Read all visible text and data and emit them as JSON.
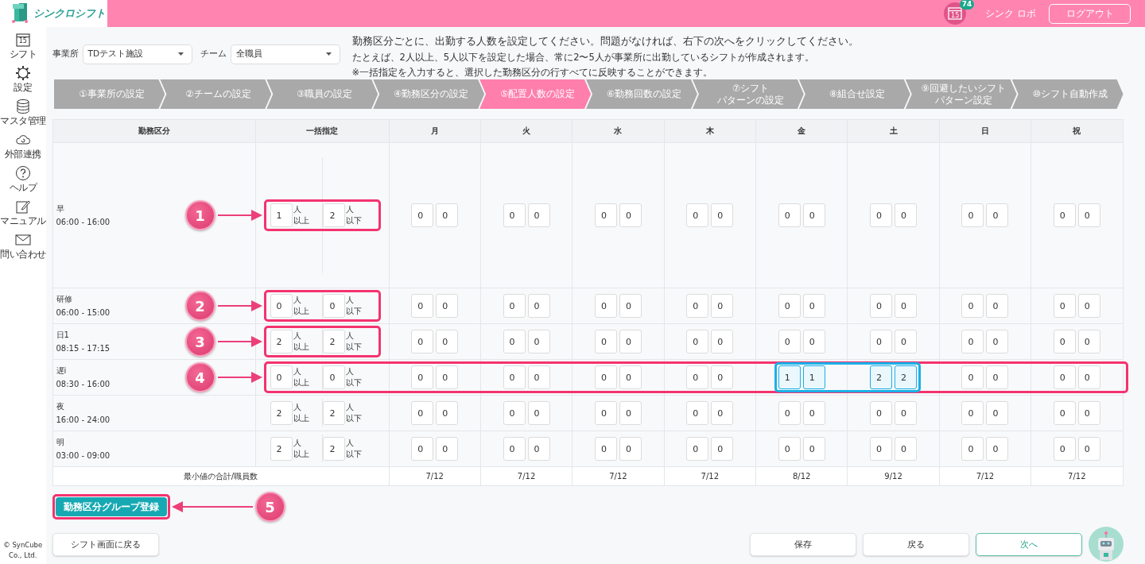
{
  "header": {
    "logo": "シンクロシフト",
    "calendar_day": "15",
    "notification_count": "74",
    "user_name": "シンク ロボ",
    "logout": "ログアウト"
  },
  "sidebar": {
    "items": [
      {
        "label": "シフト",
        "icon_text": "15"
      },
      {
        "label": "設定"
      },
      {
        "label": "マスタ管理"
      },
      {
        "label": "外部連携"
      },
      {
        "label": "ヘルプ"
      },
      {
        "label": "マニュアル"
      },
      {
        "label": "問い合わせ"
      }
    ],
    "copyright": "© SynCube Co., Ltd."
  },
  "filters": [
    {
      "label": "事業所",
      "value": "TDテスト施設"
    },
    {
      "label": "チーム",
      "value": "全職員"
    }
  ],
  "instructions": [
    "勤務区分ごとに、出勤する人数を設定してください。問題がなければ、右下の次へをクリックしてください。",
    "たとえば、2人以上、5人以下を設定した場合、常に2〜5人が事業所に出勤しているシフトが作成されます。",
    "※一括指定を入力すると、選択した勤務区分の行すべてに反映することができます。"
  ],
  "steps": [
    {
      "lines": [
        "①事業所の設定"
      ],
      "selected": false
    },
    {
      "lines": [
        "②チームの設定"
      ],
      "selected": false
    },
    {
      "lines": [
        "③職員の設定"
      ],
      "selected": false
    },
    {
      "lines": [
        "④勤務区分の設定"
      ],
      "selected": false
    },
    {
      "lines": [
        "⑤配置人数の設定"
      ],
      "selected": true
    },
    {
      "lines": [
        "⑥勤務回数の設定"
      ],
      "selected": false
    },
    {
      "lines": [
        "⑦シフト",
        "パターンの設定"
      ],
      "selected": false
    },
    {
      "lines": [
        "⑧組合せ設定"
      ],
      "selected": false
    },
    {
      "lines": [
        "⑨回避したいシフト",
        "パターン設定"
      ],
      "selected": false
    },
    {
      "lines": [
        "⑩シフト自動作成"
      ],
      "selected": false
    }
  ],
  "table": {
    "columns": [
      "勤務区分",
      "一括指定",
      "月",
      "火",
      "水",
      "木",
      "金",
      "土",
      "日",
      "祝"
    ],
    "rows": [
      {
        "name": "早",
        "time": "06:00 - 16:00",
        "kind": "tall",
        "callout": {
          "number": "1",
          "kind": "bulk"
        },
        "bulk": [
          {
            "value": "1",
            "unit": [
              "人",
              "以上"
            ]
          },
          {
            "value": "2",
            "unit": [
              "人",
              "以下"
            ]
          }
        ],
        "days": [
          {
            "min": "0",
            "max": "0",
            "highlighted": false
          },
          {
            "min": "0",
            "max": "0",
            "highlighted": false
          },
          {
            "min": "0",
            "max": "0",
            "highlighted": false
          },
          {
            "min": "0",
            "max": "0",
            "highlighted": false
          },
          {
            "min": "0",
            "max": "0",
            "highlighted": false
          },
          {
            "min": "0",
            "max": "0",
            "highlighted": false
          },
          {
            "min": "0",
            "max": "0",
            "highlighted": false
          },
          {
            "min": "0",
            "max": "0",
            "highlighted": false
          }
        ]
      },
      {
        "name": "研修",
        "time": "06:00 - 15:00",
        "kind": "normal",
        "callout": {
          "number": "2",
          "kind": "bulk"
        },
        "bulk": [
          {
            "value": "0",
            "unit": [
              "人",
              "以上"
            ]
          },
          {
            "value": "0",
            "unit": [
              "人",
              "以下"
            ]
          }
        ],
        "days": [
          {
            "min": "0",
            "max": "0",
            "highlighted": false
          },
          {
            "min": "0",
            "max": "0",
            "highlighted": false
          },
          {
            "min": "0",
            "max": "0",
            "highlighted": false
          },
          {
            "min": "0",
            "max": "0",
            "highlighted": false
          },
          {
            "min": "0",
            "max": "0",
            "highlighted": false
          },
          {
            "min": "0",
            "max": "0",
            "highlighted": false
          },
          {
            "min": "0",
            "max": "0",
            "highlighted": false
          },
          {
            "min": "0",
            "max": "0",
            "highlighted": false
          }
        ]
      },
      {
        "name": "日1",
        "time": "08:15 - 17:15",
        "kind": "normal",
        "callout": {
          "number": "3",
          "kind": "bulk"
        },
        "bulk": [
          {
            "value": "2",
            "unit": [
              "人",
              "以上"
            ]
          },
          {
            "value": "2",
            "unit": [
              "人",
              "以下"
            ]
          }
        ],
        "days": [
          {
            "min": "0",
            "max": "0",
            "highlighted": false
          },
          {
            "min": "0",
            "max": "0",
            "highlighted": false
          },
          {
            "min": "0",
            "max": "0",
            "highlighted": false
          },
          {
            "min": "0",
            "max": "0",
            "highlighted": false
          },
          {
            "min": "0",
            "max": "0",
            "highlighted": false
          },
          {
            "min": "0",
            "max": "0",
            "highlighted": false
          },
          {
            "min": "0",
            "max": "0",
            "highlighted": false
          },
          {
            "min": "0",
            "max": "0",
            "highlighted": false
          }
        ]
      },
      {
        "name": "遅i",
        "time": "08:30 - 16:00",
        "kind": "normal",
        "callout": {
          "number": "4",
          "kind": "row"
        },
        "bulk": [
          {
            "value": "0",
            "unit": [
              "人",
              "以上"
            ]
          },
          {
            "value": "0",
            "unit": [
              "人",
              "以下"
            ]
          }
        ],
        "days": [
          {
            "min": "0",
            "max": "0",
            "highlighted": false
          },
          {
            "min": "0",
            "max": "0",
            "highlighted": false
          },
          {
            "min": "0",
            "max": "0",
            "highlighted": false
          },
          {
            "min": "0",
            "max": "0",
            "highlighted": false
          },
          {
            "min": "1",
            "max": "1",
            "highlighted": true
          },
          {
            "min": "2",
            "max": "2",
            "highlighted": true
          },
          {
            "min": "0",
            "max": "0",
            "highlighted": false
          },
          {
            "min": "0",
            "max": "0",
            "highlighted": false
          }
        ]
      },
      {
        "name": "夜",
        "time": "16:00 - 24:00",
        "kind": "normal",
        "bulk": [
          {
            "value": "2",
            "unit": [
              "人",
              "以上"
            ]
          },
          {
            "value": "2",
            "unit": [
              "人",
              "以下"
            ]
          }
        ],
        "days": [
          {
            "min": "0",
            "max": "0",
            "highlighted": false
          },
          {
            "min": "0",
            "max": "0",
            "highlighted": false
          },
          {
            "min": "0",
            "max": "0",
            "highlighted": false
          },
          {
            "min": "0",
            "max": "0",
            "highlighted": false
          },
          {
            "min": "0",
            "max": "0",
            "highlighted": false
          },
          {
            "min": "0",
            "max": "0",
            "highlighted": false
          },
          {
            "min": "0",
            "max": "0",
            "highlighted": false
          },
          {
            "min": "0",
            "max": "0",
            "highlighted": false
          }
        ]
      },
      {
        "name": "明",
        "time": "03:00 - 09:00",
        "kind": "normal",
        "bulk": [
          {
            "value": "2",
            "unit": [
              "人",
              "以上"
            ]
          },
          {
            "value": "2",
            "unit": [
              "人",
              "以下"
            ]
          }
        ],
        "days": [
          {
            "min": "0",
            "max": "0",
            "highlighted": false
          },
          {
            "min": "0",
            "max": "0",
            "highlighted": false
          },
          {
            "min": "0",
            "max": "0",
            "highlighted": false
          },
          {
            "min": "0",
            "max": "0",
            "highlighted": false
          },
          {
            "min": "0",
            "max": "0",
            "highlighted": false
          },
          {
            "min": "0",
            "max": "0",
            "highlighted": false
          },
          {
            "min": "0",
            "max": "0",
            "highlighted": false
          },
          {
            "min": "0",
            "max": "0",
            "highlighted": false
          }
        ]
      }
    ],
    "summary": {
      "label": "最小値の合計/職員数",
      "values": [
        "7/12",
        "7/12",
        "7/12",
        "7/12",
        "8/12",
        "9/12",
        "7/12",
        "7/12"
      ]
    }
  },
  "group_button": {
    "label": "勤務区分グループ登録",
    "callout": {
      "number": "5"
    }
  },
  "back_button": "シフト画面に戻る",
  "actions": [
    {
      "label": "保存",
      "kind": "plain"
    },
    {
      "label": "戻る",
      "kind": "plain"
    },
    {
      "label": "次へ",
      "kind": "primary"
    }
  ]
}
